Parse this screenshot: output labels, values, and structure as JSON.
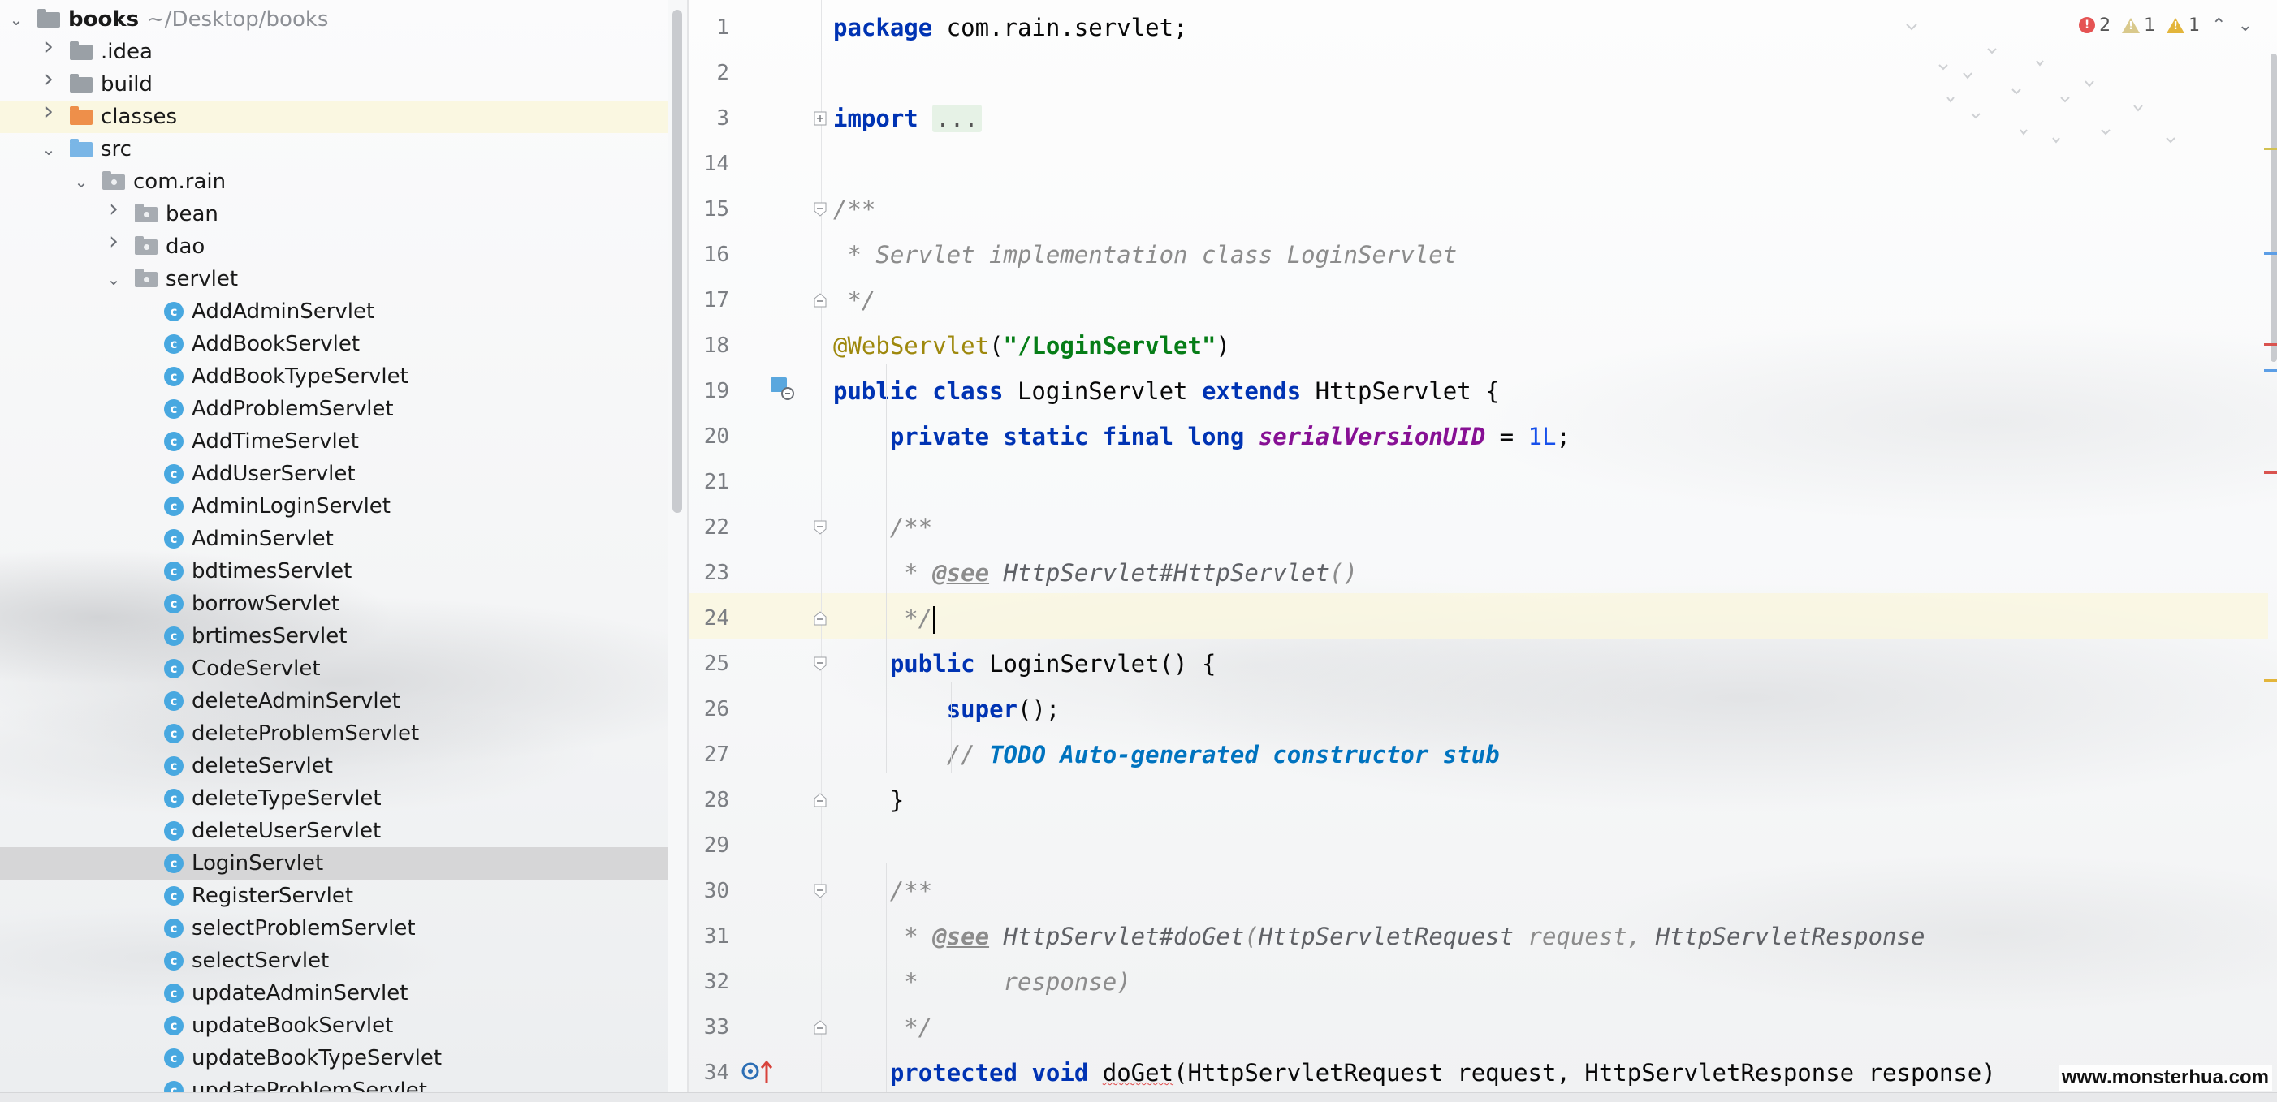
{
  "tree": {
    "nodes": [
      {
        "label": "books",
        "path": "~/Desktop/books",
        "depth": 0,
        "expanded": true,
        "icon": "folder",
        "bold": true
      },
      {
        "label": ".idea",
        "depth": 1,
        "expanded": false,
        "icon": "folder"
      },
      {
        "label": "build",
        "depth": 1,
        "expanded": false,
        "icon": "folder"
      },
      {
        "label": "classes",
        "depth": 1,
        "expanded": false,
        "icon": "folder-excluded",
        "highlight": true
      },
      {
        "label": "src",
        "depth": 1,
        "expanded": true,
        "icon": "folder-source"
      },
      {
        "label": "com.rain",
        "depth": 2,
        "expanded": true,
        "icon": "package"
      },
      {
        "label": "bean",
        "depth": 3,
        "expanded": false,
        "icon": "package"
      },
      {
        "label": "dao",
        "depth": 3,
        "expanded": false,
        "icon": "package"
      },
      {
        "label": "servlet",
        "depth": 3,
        "expanded": true,
        "icon": "package"
      },
      {
        "label": "AddAdminServlet",
        "depth": 4,
        "icon": "class"
      },
      {
        "label": "AddBookServlet",
        "depth": 4,
        "icon": "class"
      },
      {
        "label": "AddBookTypeServlet",
        "depth": 4,
        "icon": "class"
      },
      {
        "label": "AddProblemServlet",
        "depth": 4,
        "icon": "class"
      },
      {
        "label": "AddTimeServlet",
        "depth": 4,
        "icon": "class"
      },
      {
        "label": "AddUserServlet",
        "depth": 4,
        "icon": "class"
      },
      {
        "label": "AdminLoginServlet",
        "depth": 4,
        "icon": "class"
      },
      {
        "label": "AdminServlet",
        "depth": 4,
        "icon": "class"
      },
      {
        "label": "bdtimesServlet",
        "depth": 4,
        "icon": "class"
      },
      {
        "label": "borrowServlet",
        "depth": 4,
        "icon": "class"
      },
      {
        "label": "brtimesServlet",
        "depth": 4,
        "icon": "class"
      },
      {
        "label": "CodeServlet",
        "depth": 4,
        "icon": "class"
      },
      {
        "label": "deleteAdminServlet",
        "depth": 4,
        "icon": "class"
      },
      {
        "label": "deleteProblemServlet",
        "depth": 4,
        "icon": "class"
      },
      {
        "label": "deleteServlet",
        "depth": 4,
        "icon": "class"
      },
      {
        "label": "deleteTypeServlet",
        "depth": 4,
        "icon": "class"
      },
      {
        "label": "deleteUserServlet",
        "depth": 4,
        "icon": "class"
      },
      {
        "label": "LoginServlet",
        "depth": 4,
        "icon": "class",
        "selected": true
      },
      {
        "label": "RegisterServlet",
        "depth": 4,
        "icon": "class"
      },
      {
        "label": "selectProblemServlet",
        "depth": 4,
        "icon": "class"
      },
      {
        "label": "selectServlet",
        "depth": 4,
        "icon": "class"
      },
      {
        "label": "updateAdminServlet",
        "depth": 4,
        "icon": "class"
      },
      {
        "label": "updateBookServlet",
        "depth": 4,
        "icon": "class"
      },
      {
        "label": "updateBookTypeServlet",
        "depth": 4,
        "icon": "class"
      },
      {
        "label": "updateProblemServlet",
        "depth": 4,
        "icon": "class"
      }
    ]
  },
  "inspections": {
    "errors": "2",
    "warnings": "1",
    "weak_warnings": "1",
    "icons": {
      "error": "error-circle-icon",
      "warning": "warning-triangle-icon",
      "nav": "chevron-up-down-icon"
    }
  },
  "editor": {
    "caret_line": "24",
    "lines": [
      {
        "n": "1",
        "tokens": [
          {
            "t": "package",
            "c": "kw"
          },
          {
            "t": " com.rain.servlet;"
          }
        ]
      },
      {
        "n": "2",
        "tokens": []
      },
      {
        "n": "3",
        "fold": "plus",
        "tokens": [
          {
            "t": "import",
            "c": "kw"
          },
          {
            "t": " "
          },
          {
            "t": "...",
            "c": "folded"
          }
        ]
      },
      {
        "n": "14",
        "tokens": []
      },
      {
        "n": "15",
        "fold": "open",
        "tokens": [
          {
            "t": "/**",
            "c": "cm"
          }
        ]
      },
      {
        "n": "16",
        "tokens": [
          {
            "t": " * Servlet implementation class LoginServlet",
            "c": "cm"
          }
        ]
      },
      {
        "n": "17",
        "fold": "close",
        "tokens": [
          {
            "t": " */",
            "c": "cm"
          }
        ]
      },
      {
        "n": "18",
        "tokens": [
          {
            "t": "@WebServlet",
            "c": "ann"
          },
          {
            "t": "("
          },
          {
            "t": "\"/LoginServlet\"",
            "c": "str"
          },
          {
            "t": ")"
          }
        ]
      },
      {
        "n": "19",
        "gutter": "servlet-icon",
        "tokens": [
          {
            "t": "public class",
            "c": "kw"
          },
          {
            "t": " LoginServlet "
          },
          {
            "t": "extends",
            "c": "kw"
          },
          {
            "t": " HttpServlet {"
          }
        ]
      },
      {
        "n": "20",
        "tokens": [
          {
            "t": "    "
          },
          {
            "t": "private static final long",
            "c": "kw"
          },
          {
            "t": " "
          },
          {
            "t": "serialVersionUID",
            "c": "field"
          },
          {
            "t": " = "
          },
          {
            "t": "1L",
            "c": "num"
          },
          {
            "t": ";"
          }
        ]
      },
      {
        "n": "21",
        "tokens": []
      },
      {
        "n": "22",
        "fold": "open",
        "tokens": [
          {
            "t": "    "
          },
          {
            "t": "/**",
            "c": "cm"
          }
        ]
      },
      {
        "n": "23",
        "tokens": [
          {
            "t": "     * ",
            "c": "cm"
          },
          {
            "t": "@see",
            "c": "tag"
          },
          {
            "t": " HttpServlet#HttpServlet",
            "c": "ref"
          },
          {
            "t": "()",
            "c": "cm"
          }
        ]
      },
      {
        "n": "24",
        "fold": "close",
        "caret": true,
        "tokens": [
          {
            "t": "     */",
            "c": "cm"
          }
        ]
      },
      {
        "n": "25",
        "fold": "open",
        "tokens": [
          {
            "t": "    "
          },
          {
            "t": "public",
            "c": "kw"
          },
          {
            "t": " LoginServlet() {"
          }
        ]
      },
      {
        "n": "26",
        "tokens": [
          {
            "t": "        "
          },
          {
            "t": "super",
            "c": "kw"
          },
          {
            "t": "();"
          }
        ]
      },
      {
        "n": "27",
        "tokens": [
          {
            "t": "        "
          },
          {
            "t": "// ",
            "c": "cm"
          },
          {
            "t": "TODO Auto-generated constructor stub",
            "c": "todo"
          }
        ]
      },
      {
        "n": "28",
        "fold": "close",
        "tokens": [
          {
            "t": "    }"
          }
        ]
      },
      {
        "n": "29",
        "tokens": []
      },
      {
        "n": "30",
        "fold": "open",
        "tokens": [
          {
            "t": "    "
          },
          {
            "t": "/**",
            "c": "cm"
          }
        ]
      },
      {
        "n": "31",
        "tokens": [
          {
            "t": "     * ",
            "c": "cm"
          },
          {
            "t": "@see",
            "c": "tag"
          },
          {
            "t": " HttpServlet#doGet",
            "c": "ref"
          },
          {
            "t": "(",
            "c": "cm"
          },
          {
            "t": "HttpServletRequest",
            "c": "ref"
          },
          {
            "t": " request, ",
            "c": "cm"
          },
          {
            "t": "HttpServletResponse",
            "c": "ref"
          }
        ]
      },
      {
        "n": "32",
        "tokens": [
          {
            "t": "     *      response)",
            "c": "cm"
          }
        ]
      },
      {
        "n": "33",
        "fold": "close",
        "tokens": [
          {
            "t": "     */",
            "c": "cm"
          }
        ]
      },
      {
        "n": "34",
        "gutter": "override-icon",
        "tokens": [
          {
            "t": "    "
          },
          {
            "t": "protected void",
            "c": "kw"
          },
          {
            "t": " "
          },
          {
            "t": "doGet",
            "c": "squig"
          },
          {
            "t": "(HttpServletRequest request, HttpServletResponse response)"
          }
        ]
      }
    ]
  },
  "marker_colors": {
    "warning": "#d2c152",
    "info": "#5c9ee6",
    "error": "#d9534f",
    "todo": "#e3b53b"
  },
  "watermark": "www.monsterhua.com"
}
